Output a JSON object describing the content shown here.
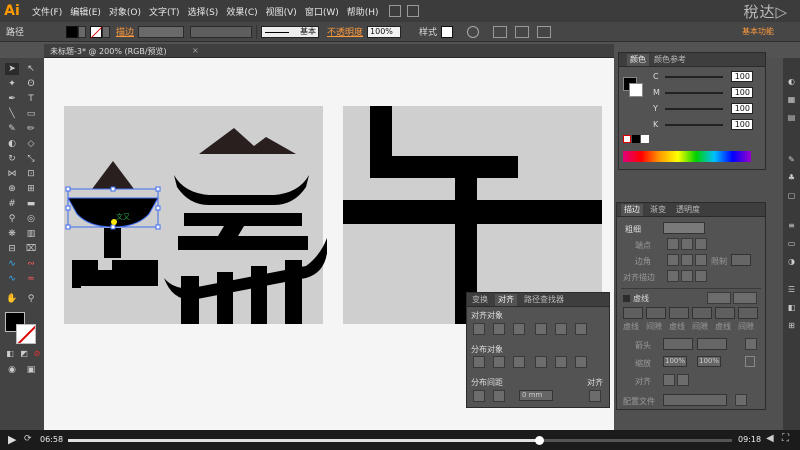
{
  "app": {
    "logo": "Ai",
    "watermark": "稅达▷"
  },
  "menu": [
    "文件(F)",
    "编辑(E)",
    "对象(O)",
    "文字(T)",
    "选择(S)",
    "效果(C)",
    "视图(V)",
    "窗口(W)",
    "帮助(H)"
  ],
  "control_bar": {
    "selection_label": "路径",
    "stroke_label": "描边",
    "stroke_style": "基本",
    "opacity_label": "不透明度",
    "opacity_value": "100%",
    "style_label": "样式",
    "workspace": "基本功能"
  },
  "document": {
    "tab_title": "未标题-3* @ 200% (RGB/预览)"
  },
  "canvas": {
    "selection_label": "文又"
  },
  "color_panel": {
    "tabs": [
      "颜色",
      "颜色参考"
    ],
    "channels": [
      {
        "name": "C",
        "value": "100"
      },
      {
        "name": "M",
        "value": "100"
      },
      {
        "name": "Y",
        "value": "100"
      },
      {
        "name": "K",
        "value": "100"
      }
    ]
  },
  "stroke_panel": {
    "tabs": [
      "描边",
      "渐变",
      "透明度"
    ],
    "weight_label": "粗细",
    "cap_label": "端点",
    "corner_label": "边角",
    "limit_label": "限制",
    "align_label": "对齐描边",
    "dashed_label": "虚线",
    "dash_fields": [
      "虚线",
      "间隙",
      "虚线",
      "间隙",
      "虚线",
      "间隙"
    ],
    "arrow_label": "箭头",
    "scale_label": "缩放",
    "scale_values": [
      "100%",
      "100%"
    ],
    "align2_label": "对齐",
    "profile_label": "配置文件"
  },
  "align_panel": {
    "tabs": [
      "变换",
      "对齐",
      "路径查找器"
    ],
    "align_objects_label": "对齐对象",
    "distribute_objects_label": "分布对象",
    "distribute_spacing_label": "分布间距",
    "spacing_value": "0 mm",
    "align_to_label": "对齐"
  },
  "player": {
    "current_time": "06:58",
    "total_time": "09:18",
    "progress": 0.71
  }
}
